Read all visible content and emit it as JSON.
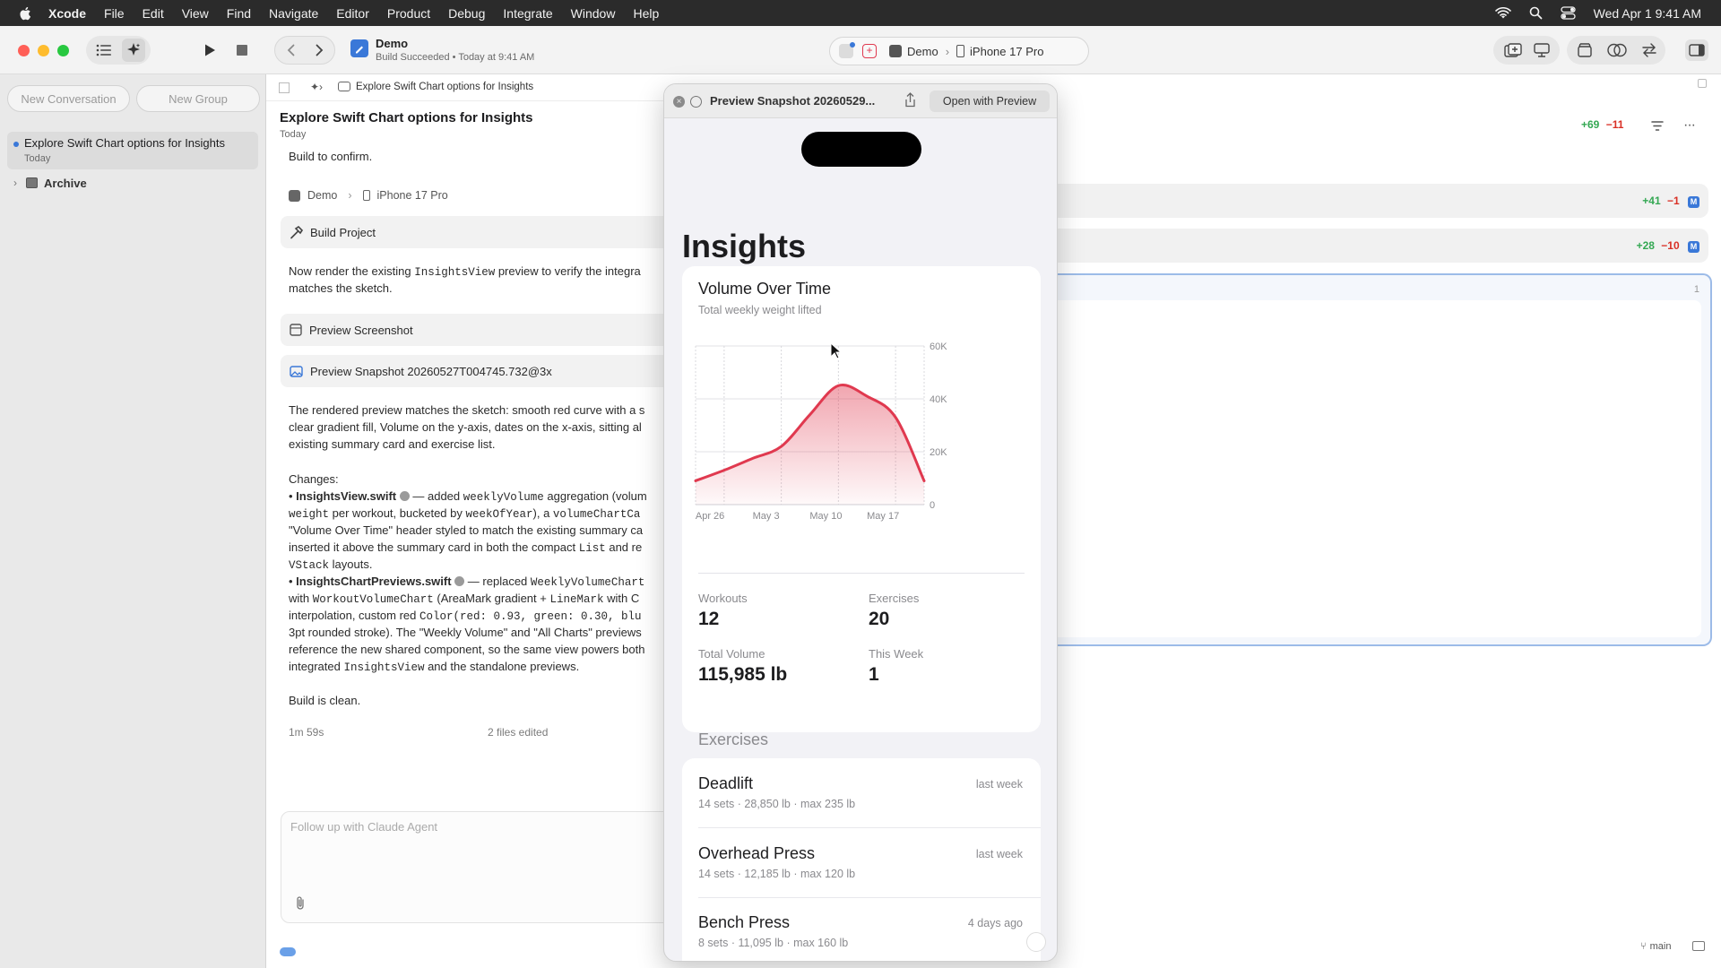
{
  "menubar": {
    "app": "Xcode",
    "items": [
      "File",
      "Edit",
      "View",
      "Find",
      "Navigate",
      "Editor",
      "Product",
      "Debug",
      "Integrate",
      "Window",
      "Help"
    ],
    "clock": "Wed Apr 1  9:41 AM"
  },
  "toolbar": {
    "project": "Demo",
    "status": "Build Succeeded • Today at 9:41 AM",
    "scheme": "Demo",
    "device": "iPhone 17 Pro"
  },
  "sidebar": {
    "new_conversation": "New Conversation",
    "new_group": "New Group",
    "items": [
      {
        "title": "Explore Swift Chart options for Insights",
        "subtitle": "Today"
      },
      {
        "title": "Archive"
      }
    ]
  },
  "conversation": {
    "breadcrumb": "Explore Swift Chart options for Insights",
    "title": "Explore Swift Chart options for Insights",
    "date": "Today",
    "line_build_confirm": "Build to confirm.",
    "dest_scheme": "Demo",
    "dest_device": "iPhone 17 Pro",
    "build_project": "Build Project",
    "render_1a": "Now render the existing ",
    "render_1b": "InsightsView",
    "render_1c": " preview to verify the integra",
    "render_2": "matches the sketch.",
    "preview_screenshot": "Preview Screenshot",
    "preview_snapshot": "Preview Snapshot 20260527T004745.732@3x",
    "result_1": "The rendered preview matches the sketch: smooth red curve with a s",
    "result_2": "clear gradient fill, Volume on the y-axis, dates on the x-axis, sitting al",
    "result_3": "existing summary card and exercise list.",
    "changes": "Changes:",
    "c1_file": "InsightsView.swift",
    "c1_a": " — added ",
    "c1_b": "weeklyVolume",
    "c1_c": " aggregation (volum",
    "c2_a": "weight",
    "c2_b": " per workout, bucketed by ",
    "c2_c": "weekOfYear",
    "c2_d": "), a ",
    "c2_e": "volumeChartCa",
    "c3": "\"Volume Over Time\" header styled to match the existing summary ca",
    "c4_a": "inserted it above the summary card in both the compact ",
    "c4_b": "List",
    "c4_c": " and re",
    "c5_a": "VStack",
    "c5_b": " layouts.",
    "c6_file": "InsightsChartPreviews.swift",
    "c6_a": " — replaced ",
    "c6_b": "WeeklyVolumeChart",
    "c7_a": "with ",
    "c7_b": "WorkoutVolumeChart",
    "c7_c": " (AreaMark gradient + ",
    "c7_d": "LineMark",
    "c7_e": " with C",
    "c8_a": "interpolation, custom red ",
    "c8_b": "Color(red: 0.93, green: 0.30, blu",
    "c9": "3pt rounded stroke). The \"Weekly Volume\" and \"All Charts\" previews",
    "c10": "reference the new shared component, so the same view powers both",
    "c11_a": "integrated ",
    "c11_b": "InsightsView",
    "c11_c": " and the standalone previews.",
    "build_clean": "Build is clean.",
    "elapsed": "1m 59s",
    "files_edited": "2 files edited",
    "followup_placeholder": "Follow up with Claude Agent"
  },
  "editor": {
    "summary_plus": "+69",
    "summary_minus": "−11",
    "file1_plus": "+41",
    "file1_minus": "−1",
    "file2_plus": "+28",
    "file2_minus": "−10",
    "badge": "M",
    "line_number": "1",
    "branch": "main"
  },
  "preview": {
    "title": "Preview Snapshot 20260529...",
    "open_with": "Open with Preview",
    "screen_title": "Insights",
    "chart_title": "Volume Over Time",
    "chart_subtitle": "Total weekly weight lifted",
    "stats": [
      {
        "label": "Workouts",
        "value": "12"
      },
      {
        "label": "Exercises",
        "value": "20"
      },
      {
        "label": "Total Volume",
        "value": "115,985 lb"
      },
      {
        "label": "This Week",
        "value": "1"
      }
    ],
    "exercises_header": "Exercises",
    "exercises": [
      {
        "name": "Deadlift",
        "detail": "14 sets · 28,850 lb · max 235 lb",
        "when": "last week"
      },
      {
        "name": "Overhead Press",
        "detail": "14 sets · 12,185 lb · max 120 lb",
        "when": "last week"
      },
      {
        "name": "Bench Press",
        "detail": "8 sets · 11,095 lb · max 160 lb",
        "when": "4 days ago"
      }
    ]
  },
  "colors": {
    "accent": "#e0394f",
    "menubar": "#2b2b2b"
  },
  "chart_data": {
    "type": "area",
    "x": [
      "Apr 22",
      "Apr 26",
      "Apr 29",
      "May 3",
      "May 6",
      "May 10",
      "May 13",
      "May 17",
      "May 20"
    ],
    "series": [
      {
        "values": [
          9000,
          13000,
          17500,
          22000,
          34000,
          45000,
          41000,
          33000,
          9000
        ]
      }
    ],
    "xticks": [
      "Apr 26",
      "May 3",
      "May 10",
      "May 17"
    ],
    "yticks": [
      "0",
      "20K",
      "40K",
      "60K"
    ],
    "ylim": [
      0,
      60000
    ],
    "grid": true
  }
}
